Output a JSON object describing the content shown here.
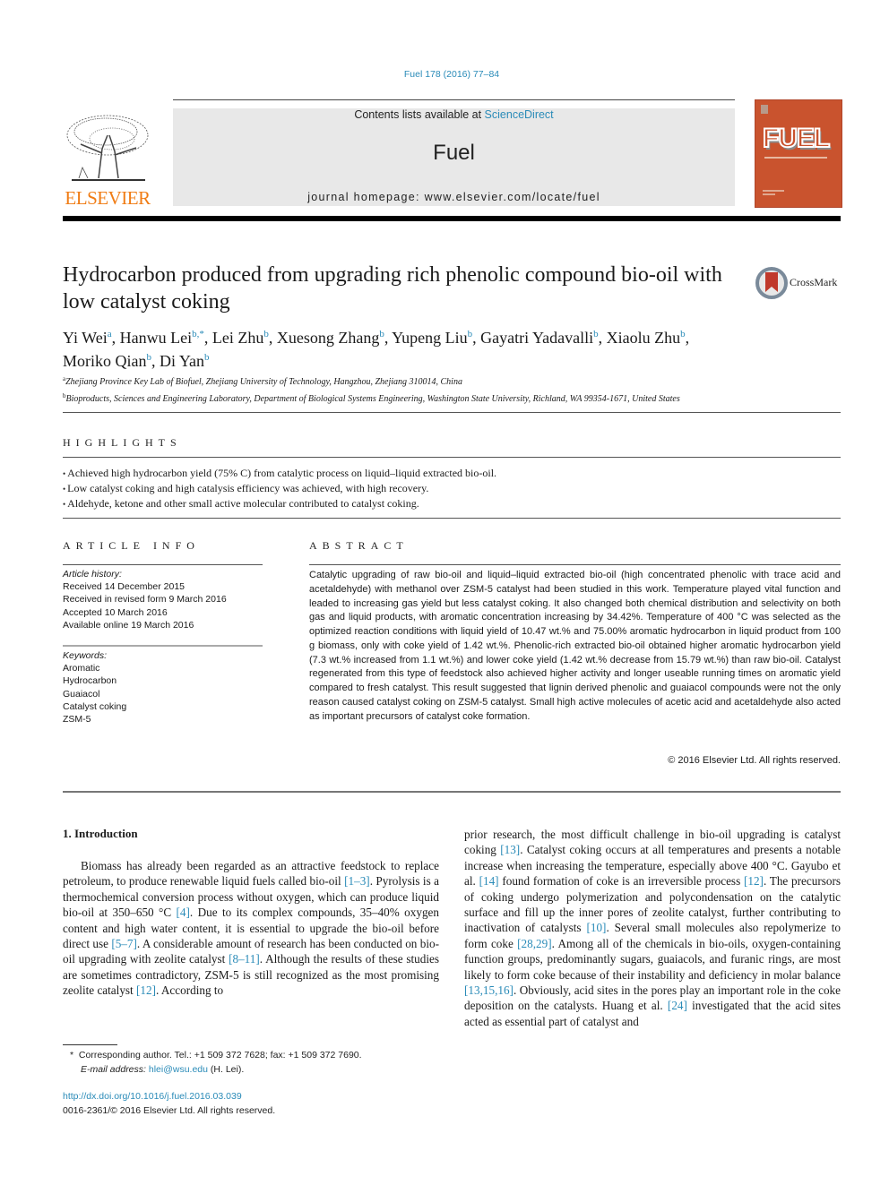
{
  "header": {
    "journal_ref": "Fuel 178 (2016) 77–84",
    "contents_prefix": "Contents lists available at ",
    "contents_link": "ScienceDirect",
    "journal_name": "Fuel",
    "homepage": "journal homepage: www.elsevier.com/locate/fuel",
    "publisher": "ELSEVIER",
    "cover_title": "FUEL",
    "accent_color": "#f07c14",
    "link_color": "#2a8bb8",
    "cover_color": "#c9532e"
  },
  "article": {
    "title": "Hydrocarbon produced from upgrading rich phenolic compound bio-oil with low catalyst coking",
    "crossmark": "CrossMark",
    "authors": [
      {
        "name": "Yi Wei",
        "sup": "a"
      },
      {
        "name": "Hanwu Lei",
        "sup": "b,*"
      },
      {
        "name": "Lei Zhu",
        "sup": "b"
      },
      {
        "name": "Xuesong Zhang",
        "sup": "b"
      },
      {
        "name": "Yupeng Liu",
        "sup": "b"
      },
      {
        "name": "Gayatri Yadavalli",
        "sup": "b"
      },
      {
        "name": "Xiaolu Zhu",
        "sup": "b"
      },
      {
        "name": "Moriko Qian",
        "sup": "b"
      },
      {
        "name": "Di Yan",
        "sup": "b"
      }
    ],
    "affiliations": [
      {
        "sup": "a",
        "text": "Zhejiang Province Key Lab of Biofuel, Zhejiang University of Technology, Hangzhou, Zhejiang 310014, China"
      },
      {
        "sup": "b",
        "text": "Bioproducts, Sciences and Engineering Laboratory, Department of Biological Systems Engineering, Washington State University, Richland, WA 99354-1671, United States"
      }
    ]
  },
  "highlights": {
    "heading": "HIGHLIGHTS",
    "items": [
      "Achieved high hydrocarbon yield (75% C) from catalytic process on liquid–liquid extracted bio-oil.",
      "Low catalyst coking and high catalysis efficiency was achieved, with high recovery.",
      "Aldehyde, ketone and other small active molecular contributed to catalyst coking."
    ]
  },
  "article_info": {
    "heading": "ARTICLE INFO",
    "history_label": "Article history:",
    "history": [
      "Received 14 December 2015",
      "Received in revised form 9 March 2016",
      "Accepted 10 March 2016",
      "Available online 19 March 2016"
    ],
    "keywords_label": "Keywords:",
    "keywords": [
      "Aromatic",
      "Hydrocarbon",
      "Guaiacol",
      "Catalyst coking",
      "ZSM-5"
    ]
  },
  "abstract": {
    "heading": "ABSTRACT",
    "text": "Catalytic upgrading of raw bio-oil and liquid–liquid extracted bio-oil (high concentrated phenolic with trace acid and acetaldehyde) with methanol over ZSM-5 catalyst had been studied in this work. Temperature played vital function and leaded to increasing gas yield but less catalyst coking. It also changed both chemical distribution and selectivity on both gas and liquid products, with aromatic concentration increasing by 34.42%. Temperature of 400 °C was selected as the optimized reaction conditions with liquid yield of 10.47 wt.% and 75.00% aromatic hydrocarbon in liquid product from 100 g biomass, only with coke yield of 1.42 wt.%. Phenolic-rich extracted bio-oil obtained higher aromatic hydrocarbon yield (7.3 wt.% increased from 1.1 wt.%) and lower coke yield (1.42 wt.% decrease from 15.79 wt.%) than raw bio-oil. Catalyst regenerated from this type of feedstock also achieved higher activity and longer useable running times on aromatic yield compared to fresh catalyst. This result suggested that lignin derived phenolic and guaiacol compounds were not the only reason caused catalyst coking on ZSM-5 catalyst. Small high active molecules of acetic acid and acetaldehyde also acted as important precursors of catalyst coke formation.",
    "copyright": "© 2016 Elsevier Ltd. All rights reserved."
  },
  "introduction": {
    "heading": "1. Introduction",
    "left_column": [
      {
        "t": "Biomass has already been regarded as an attractive feedstock to replace petroleum, to produce renewable liquid fuels called bio-oil "
      },
      {
        "t": "[1–3]",
        "link": true
      },
      {
        "t": ". Pyrolysis is a thermochemical conversion process without oxygen, which can produce liquid bio-oil at 350–650 °C "
      },
      {
        "t": "[4]",
        "link": true
      },
      {
        "t": ". Due to its complex compounds, 35–40% oxygen content and high water content, it is essential to upgrade the bio-oil before direct use "
      },
      {
        "t": "[5–7]",
        "link": true
      },
      {
        "t": ". A considerable amount of research has been conducted on bio-oil upgrading with zeolite catalyst "
      },
      {
        "t": "[8–11]",
        "link": true
      },
      {
        "t": ". Although the results of these studies are sometimes contradictory, ZSM-5 is still recognized as the most promising zeolite catalyst "
      },
      {
        "t": "[12]",
        "link": true
      },
      {
        "t": ". According to"
      }
    ],
    "right_column": [
      {
        "t": "prior research, the most difficult challenge in bio-oil upgrading is catalyst coking "
      },
      {
        "t": "[13]",
        "link": true
      },
      {
        "t": ". Catalyst coking occurs at all temperatures and presents a notable increase when increasing the temperature, especially above 400 °C. Gayubo et al. "
      },
      {
        "t": "[14]",
        "link": true
      },
      {
        "t": " found formation of coke is an irreversible process "
      },
      {
        "t": "[12]",
        "link": true
      },
      {
        "t": ". The precursors of coking undergo polymerization and polycondensation on the catalytic surface and fill up the inner pores of zeolite catalyst, further contributing to inactivation of catalysts "
      },
      {
        "t": "[10]",
        "link": true
      },
      {
        "t": ". Several small molecules also repolymerize to form coke "
      },
      {
        "t": "[28,29]",
        "link": true
      },
      {
        "t": ". Among all of the chemicals in bio-oils, oxygen-containing function groups, predominantly sugars, guaiacols, and furanic rings, are most likely to form coke because of their instability and deficiency in molar balance "
      },
      {
        "t": "[13,15,16]",
        "link": true
      },
      {
        "t": ". Obviously, acid sites in the pores play an important role in the coke deposition on the catalysts. Huang et al. "
      },
      {
        "t": "[24]",
        "link": true
      },
      {
        "t": " investigated that the acid sites acted as essential part of catalyst and"
      }
    ]
  },
  "footnotes": {
    "corresponding": "Corresponding author. Tel.: +1 509 372 7628; fax: +1 509 372 7690.",
    "email_label": "E-mail address: ",
    "email": "hlei@wsu.edu",
    "email_suffix": " (H. Lei).",
    "doi": "http://dx.doi.org/10.1016/j.fuel.2016.03.039",
    "issn": "0016-2361/© 2016 Elsevier Ltd. All rights reserved."
  }
}
